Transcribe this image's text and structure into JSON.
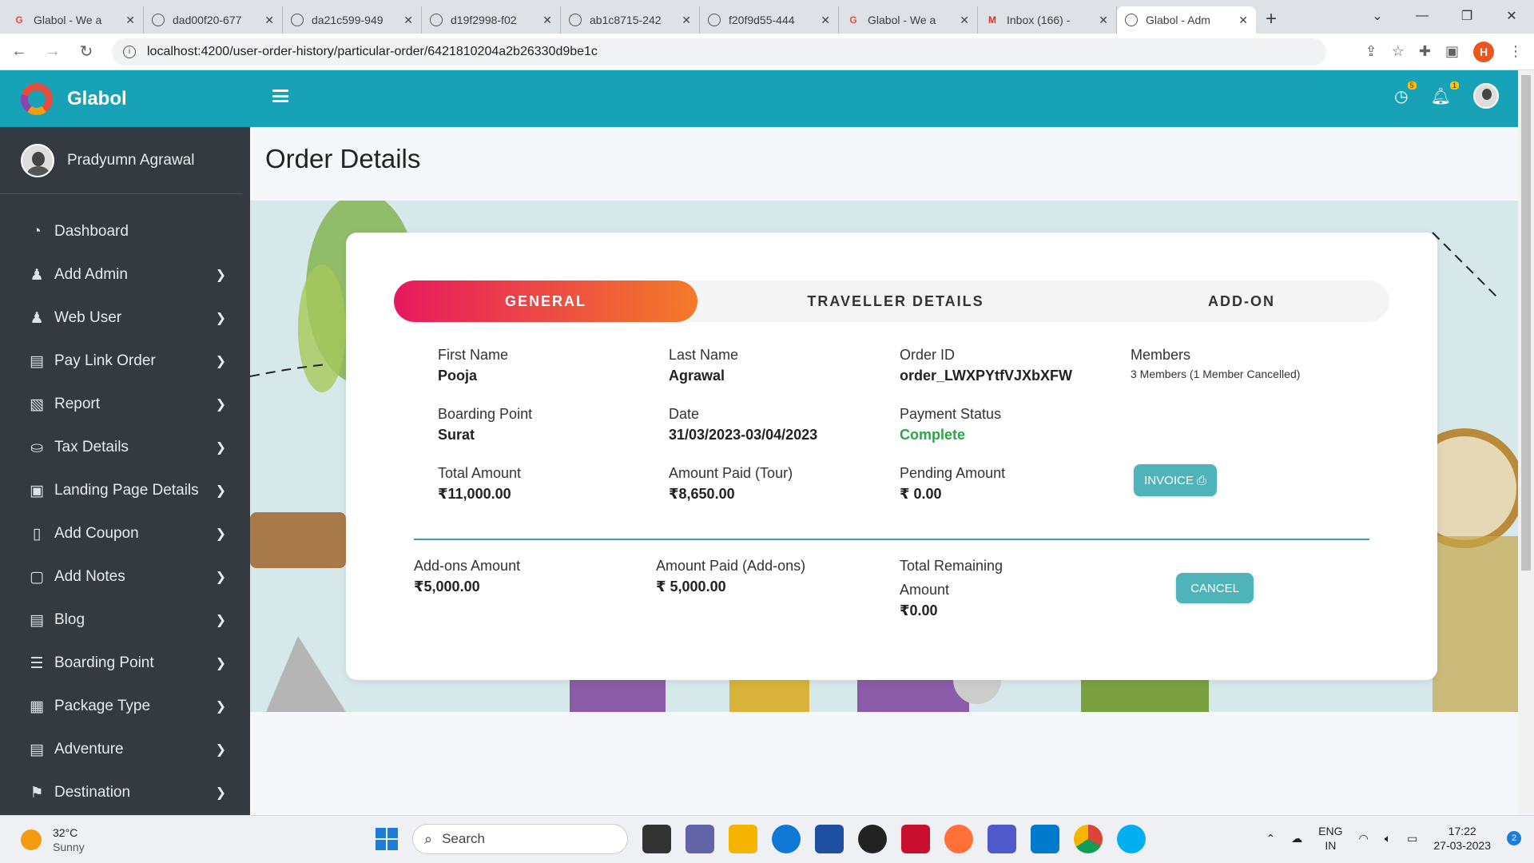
{
  "browser": {
    "tabs": [
      {
        "title": "Glabol - We a",
        "icon": "g-icon"
      },
      {
        "title": "dad00f20-677",
        "icon": "globe-icon"
      },
      {
        "title": "da21c599-949",
        "icon": "globe-icon"
      },
      {
        "title": "d19f2998-f02",
        "icon": "globe-icon"
      },
      {
        "title": "ab1c8715-242",
        "icon": "globe-icon"
      },
      {
        "title": "f20f9d55-444",
        "icon": "globe-icon"
      },
      {
        "title": "Glabol - We a",
        "icon": "g-icon"
      },
      {
        "title": "Inbox (166) -",
        "icon": "gmail-icon"
      },
      {
        "title": "Glabol - Adm",
        "icon": "globe-icon",
        "active": true
      }
    ],
    "url": "localhost:4200/user-order-history/particular-order/6421810204a2b26330d9be1c",
    "profile_initial": "H"
  },
  "app": {
    "brand": "Glabol",
    "user_name": "Pradyumn Agrawal",
    "badges": {
      "history": "5",
      "bell": "1"
    },
    "menu": [
      {
        "label": "Dashboard",
        "icon": "dashboard-icon",
        "chevron": false
      },
      {
        "label": "Add Admin",
        "icon": "user-shield-icon",
        "chevron": true
      },
      {
        "label": "Web User",
        "icon": "user-icon",
        "chevron": true
      },
      {
        "label": "Pay Link Order",
        "icon": "card-icon",
        "chevron": true
      },
      {
        "label": "Report",
        "icon": "report-icon",
        "chevron": true
      },
      {
        "label": "Tax Details",
        "icon": "tax-icon",
        "chevron": true
      },
      {
        "label": "Landing Page Details",
        "icon": "ad-icon",
        "chevron": true
      },
      {
        "label": "Add Coupon",
        "icon": "clipboard-icon",
        "chevron": true
      },
      {
        "label": "Add Notes",
        "icon": "note-icon",
        "chevron": true
      },
      {
        "label": "Blog",
        "icon": "blog-icon",
        "chevron": true
      },
      {
        "label": "Boarding Point",
        "icon": "list-icon",
        "chevron": true
      },
      {
        "label": "Package Type",
        "icon": "package-icon",
        "chevron": true
      },
      {
        "label": "Adventure",
        "icon": "adventure-icon",
        "chevron": true
      },
      {
        "label": "Destination",
        "icon": "map-icon",
        "chevron": true
      }
    ]
  },
  "page": {
    "title": "Order Details",
    "tabs": [
      "GENERAL",
      "TRAVELLER DETAILS",
      "ADD-ON"
    ],
    "fields": {
      "first_name": {
        "label": "First Name",
        "value": "Pooja"
      },
      "last_name": {
        "label": "Last Name",
        "value": "Agrawal"
      },
      "order_id": {
        "label": "Order ID",
        "value": "order_LWXPYtfVJXbXFW"
      },
      "members": {
        "label": "Members",
        "value": "3 Members (1 Member Cancelled)"
      },
      "boarding_point": {
        "label": "Boarding Point",
        "value": "Surat"
      },
      "date": {
        "label": "Date",
        "value": "31/03/2023-03/04/2023"
      },
      "payment_status": {
        "label": "Payment Status",
        "value": "Complete"
      },
      "total_amount": {
        "label": "Total Amount",
        "value": "₹11,000.00"
      },
      "amount_paid_tour": {
        "label": "Amount Paid (Tour)",
        "value": "₹8,650.00"
      },
      "pending_amount": {
        "label": "Pending Amount",
        "value": "₹ 0.00"
      },
      "addons_amount": {
        "label": "Add-ons Amount",
        "value": "₹5,000.00"
      },
      "amount_paid_addons": {
        "label": "Amount Paid (Add-ons)",
        "value": "₹ 5,000.00"
      },
      "total_remaining_line1": "Total Remaining",
      "total_remaining_line2": "Amount",
      "total_remaining_value": "₹0.00"
    },
    "invoice_label": "INVOICE",
    "cancel_label": "CANCEL"
  },
  "taskbar": {
    "temp": "32°C",
    "condition": "Sunny",
    "search": "Search",
    "lang1": "ENG",
    "lang2": "IN",
    "time": "17:22",
    "date": "27-03-2023",
    "notifications": "2"
  },
  "colors": {
    "accent": "#17a2b8",
    "sidebar": "#343a40",
    "tab_gradient_start": "#e6195f",
    "tab_gradient_end": "#f37b29",
    "status_green": "#28a745"
  }
}
